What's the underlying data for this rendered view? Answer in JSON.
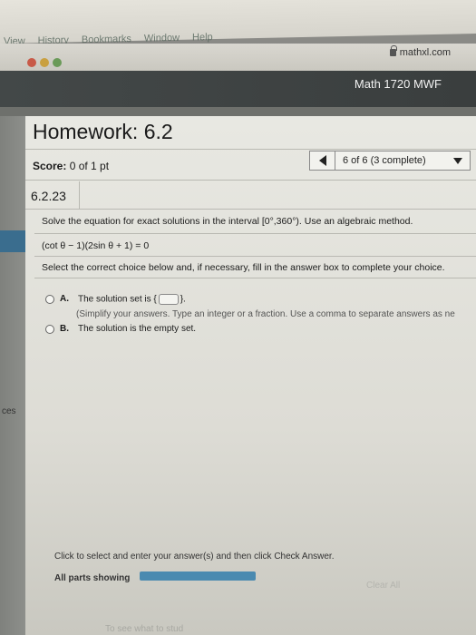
{
  "menubar": {
    "items": [
      "View",
      "History",
      "Bookmarks",
      "Window",
      "Help"
    ]
  },
  "browser": {
    "url": "mathxl.com"
  },
  "course": {
    "title": "Math 1720 MWF"
  },
  "sidebar": {
    "label": "ces"
  },
  "homework": {
    "title": "Homework: 6.2",
    "score_label": "Score:",
    "score_value": "0 of 1 pt",
    "progress": "6 of 6 (3 complete)"
  },
  "question": {
    "id": "6.2.23",
    "instruction": "Solve the equation for exact solutions in the interval [0°,360°). Use an algebraic method.",
    "equation": "(cot θ − 1)(2sin θ + 1) = 0",
    "select_note": "Select the correct choice below and, if necessary, fill in the answer box to complete your choice.",
    "choices": [
      {
        "letter": "A.",
        "text_before": "The solution set is {",
        "text_after": "}.",
        "hint": "(Simplify your answers. Type an integer or a fraction. Use a comma to separate answers as ne"
      },
      {
        "letter": "B.",
        "text": "The solution is the empty set."
      }
    ]
  },
  "footer": {
    "note": "Click to select and enter your answer(s) and then click Check Answer.",
    "all_parts": "All parts showing",
    "clear_all": "Clear All",
    "bottom_text": "To see what to stud"
  },
  "colors": {
    "course_header": "#3a3e3e",
    "accent_blue": "#4a8ab0"
  }
}
